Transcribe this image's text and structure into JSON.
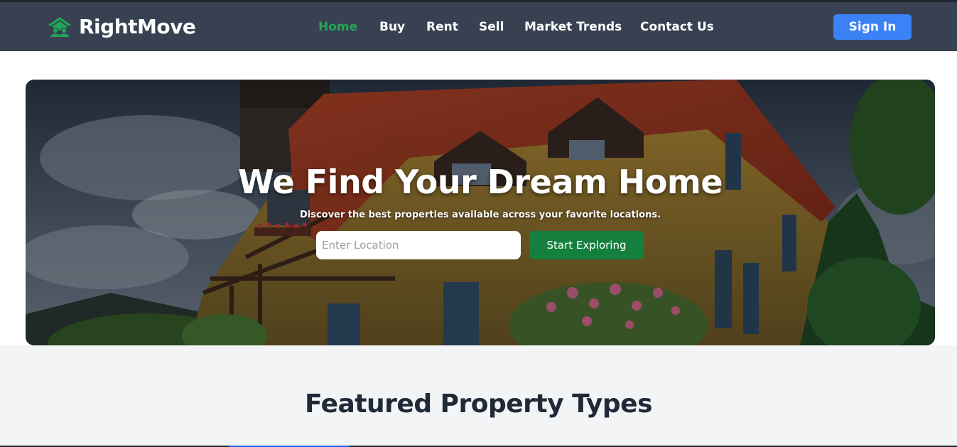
{
  "brand": {
    "name": "RightMove",
    "icon": "house-group-icon"
  },
  "nav": {
    "items": [
      {
        "label": "Home",
        "active": true
      },
      {
        "label": "Buy",
        "active": false
      },
      {
        "label": "Rent",
        "active": false
      },
      {
        "label": "Sell",
        "active": false
      },
      {
        "label": "Market Trends",
        "active": false
      },
      {
        "label": "Contact Us",
        "active": false
      }
    ],
    "signin_label": "Sign In"
  },
  "hero": {
    "title": "We Find Your Dream Home",
    "subtitle": "Discover the best properties available across your favorite locations.",
    "search": {
      "placeholder": "Enter Location",
      "value": ""
    },
    "cta_label": "Start Exploring",
    "image": "half-timbered-house-photo"
  },
  "featured": {
    "title": "Featured Property Types"
  },
  "colors": {
    "navbar_bg": "#374151",
    "accent_green": "#22a559",
    "signin_blue": "#3b82f6",
    "cta_green": "#15803d",
    "section_bg": "#f3f4f6",
    "heading_dark": "#1f2937"
  }
}
